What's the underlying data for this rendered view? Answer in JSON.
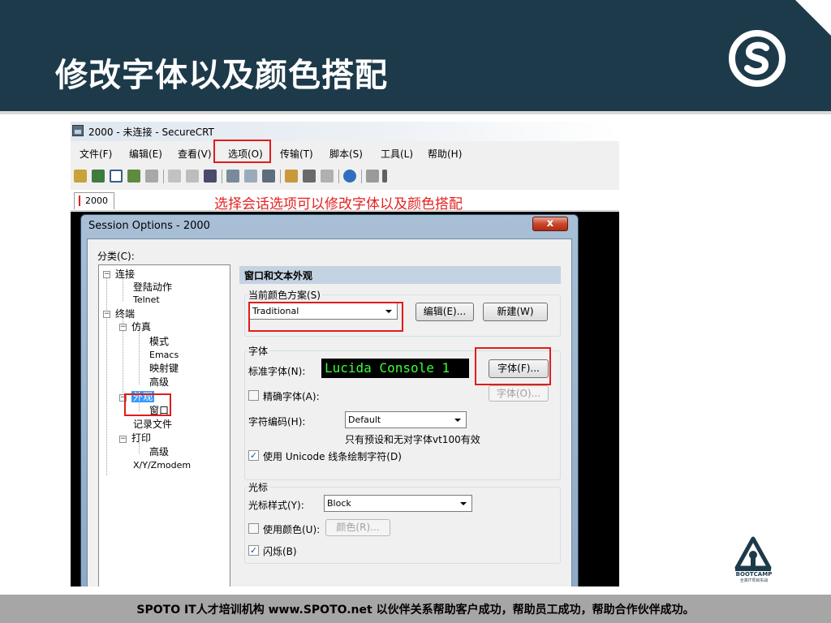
{
  "slide": {
    "title": "修改字体以及颜色搭配",
    "annotation": "选择会话选项可以修改字体以及颜色搭配",
    "footer": "SPOTO IT人才培训机构   www.SPOTO.net   以伙伴关系帮助客户成功，帮助员工成功，帮助合作伙伴成功。",
    "bootcamp_logo": "BOOTCAMP",
    "bootcamp_sub": "全真IT项目实战"
  },
  "app": {
    "title": "2000 - 未连接 - SecureCRT",
    "menu": [
      "文件(F)",
      "编辑(E)",
      "查看(V)",
      "选项(O)",
      "传输(T)",
      "脚本(S)",
      "工具(L)",
      "帮助(H)"
    ],
    "tab_label": "2000"
  },
  "dialog": {
    "title": "Session Options - 2000",
    "close_label": "x",
    "category_label": "分类(C):",
    "tree": {
      "connection": "连接",
      "logon_actions": "登陆动作",
      "telnet": "Telnet",
      "terminal": "终端",
      "emulation": "仿真",
      "modes": "模式",
      "emacs": "Emacs",
      "mapped_keys": "映射键",
      "advanced": "高级",
      "appearance": "外观",
      "window": "窗口",
      "log_file": "记录文件",
      "printing": "打印",
      "print_advanced": "高级",
      "xyzmodem": "X/Y/Zmodem"
    },
    "panel_header": "窗口和文本外观",
    "color_scheme": {
      "group_label": "当前颜色方案(S)",
      "value": "Traditional",
      "edit_button": "编辑(E)...",
      "new_button": "新建(W)"
    },
    "font": {
      "group_label": "字体",
      "normal_font_label": "标准字体(N):",
      "preview": "Lucida Console 1",
      "font_button": "字体(F)...",
      "precise_font_label": "精确字体(A):",
      "precise_font_button": "字体(O)...",
      "encoding_label": "字符编码(H):",
      "encoding_value": "Default",
      "encoding_hint": "只有预设和无对字体vt100有效",
      "unicode_label": "使用 Unicode 线条绘制字符(D)",
      "unicode_checked": true,
      "precise_checked": false
    },
    "cursor": {
      "group_label": "光标",
      "style_label": "光标样式(Y):",
      "style_value": "Block",
      "use_color_label": "使用颜色(U):",
      "color_button": "颜色(R)...",
      "use_color_checked": false,
      "blink_label": "闪烁(B)",
      "blink_checked": true
    }
  },
  "colors": {
    "header_bg": "#1d3a4a",
    "highlight": "#e21b1b",
    "selected": "#3399ff",
    "footer_bg": "#a6a6a6"
  }
}
